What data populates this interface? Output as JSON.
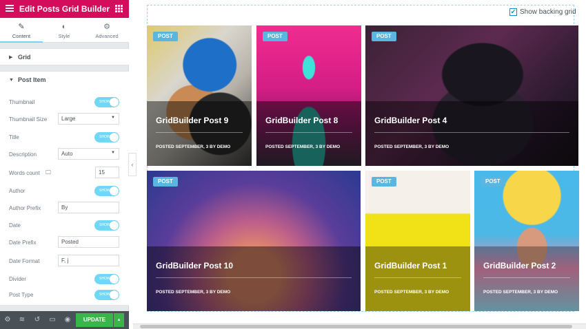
{
  "app": {
    "title": "Edit Posts Grid Builder"
  },
  "tabs": [
    {
      "label": "Content",
      "icon": "pencil-icon"
    },
    {
      "label": "Style",
      "icon": "contrast-icon"
    },
    {
      "label": "Advanced",
      "icon": "gear-icon"
    }
  ],
  "sections": {
    "grid": "Grid",
    "post_item": "Post Item"
  },
  "controls": {
    "thumbnail": {
      "label": "Thumbnail",
      "state": "SHOW"
    },
    "thumbnail_size": {
      "label": "Thumbnail Size",
      "value": "Large"
    },
    "title": {
      "label": "Title",
      "state": "SHOW"
    },
    "description": {
      "label": "Description",
      "value": "Auto"
    },
    "words_count": {
      "label": "Words count",
      "value": "15"
    },
    "author": {
      "label": "Author",
      "state": "SHOW"
    },
    "author_prefix": {
      "label": "Author Prefix",
      "value": "By"
    },
    "date": {
      "label": "Date",
      "state": "SHOW"
    },
    "date_prefix": {
      "label": "Date Prefix",
      "value": "Posted"
    },
    "date_format": {
      "label": "Date Format",
      "value": "F, j"
    },
    "divider": {
      "label": "Divider",
      "state": "SHOW"
    },
    "post_type": {
      "label": "Post Type",
      "state": "SHOW"
    }
  },
  "footer": {
    "update_label": "UPDATE"
  },
  "preview": {
    "show_grid_label": "Show backing grid",
    "show_grid_checked": true
  },
  "posts": [
    {
      "badge": "POST",
      "title": "GridBuilder Post 9",
      "meta": "POSTED  SEPTEMBER, 3     BY  DEMO"
    },
    {
      "badge": "POST",
      "title": "GridBuilder Post 8",
      "meta": "POSTED  SEPTEMBER, 3     BY  DEMO"
    },
    {
      "badge": "POST",
      "title": "GridBuilder Post 4",
      "meta": "POSTED  SEPTEMBER, 3     BY  DEMO"
    },
    {
      "badge": "POST",
      "title": "GridBuilder Post 10",
      "meta": "POSTED  SEPTEMBER, 3     BY  DEMO"
    },
    {
      "badge": "POST",
      "title": "GridBuilder Post 1",
      "meta": "POSTED  SEPTEMBER, 3     BY  DEMO"
    },
    {
      "badge": "POST",
      "title": "GridBuilder Post 2",
      "meta": "POSTED  SEPTEMBER, 3     BY  DEMO"
    }
  ],
  "colors": {
    "brand": "#d30c5c",
    "toggle": "#71d7f7",
    "update": "#39b54a",
    "badge": "#58b6e1"
  }
}
